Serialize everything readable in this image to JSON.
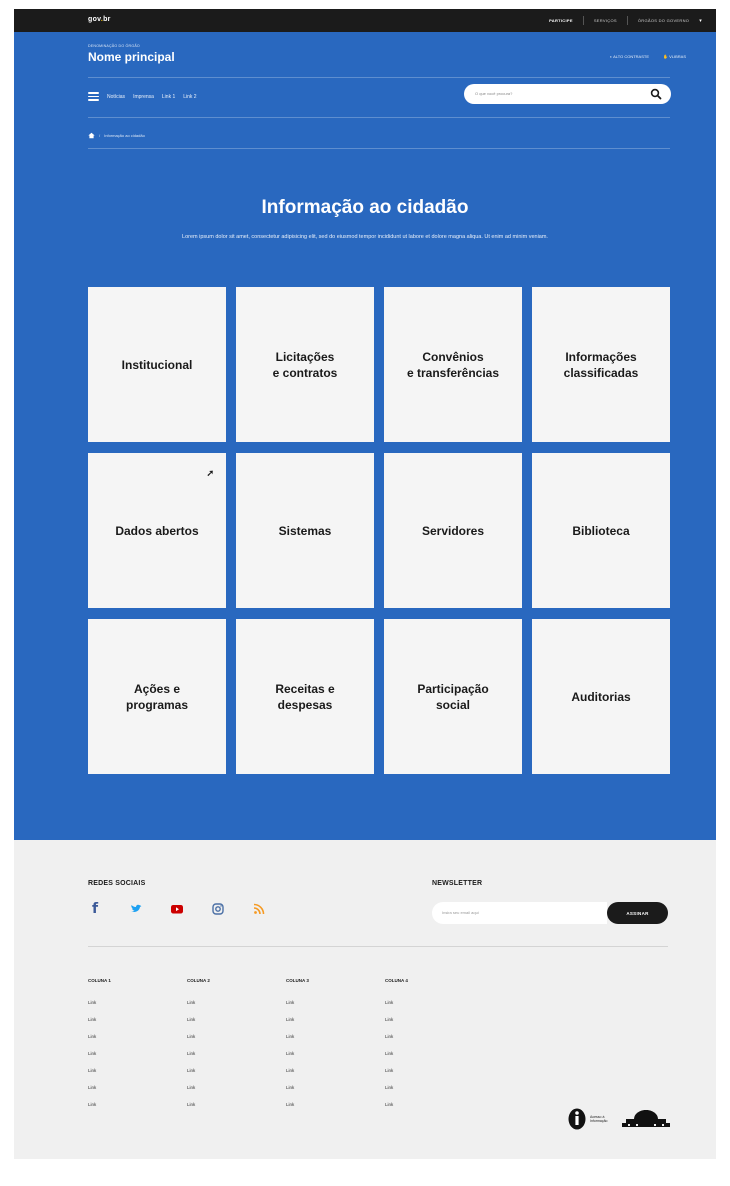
{
  "topbar": {
    "logo_prefix": "gov",
    "logo_dot": ".",
    "logo_suffix": "br",
    "links": [
      "PARTICIPE",
      "SERVIÇOS",
      "ÓRGÃOS DO GOVERNO"
    ]
  },
  "header": {
    "small_label": "DENOMINAÇÃO DO ÓRGÃO",
    "site_name": "Nome principal",
    "contrast_label": "ALTO CONTRASTE",
    "vlibras_label": "VLIBRAS"
  },
  "menu": {
    "items": [
      "Notícias",
      "Imprensa",
      "Link 1",
      "Link 2"
    ]
  },
  "search": {
    "placeholder": "O que você procura?"
  },
  "breadcrumb": {
    "current": "Informação ao cidadão"
  },
  "hero": {
    "title": "Informação ao cidadão",
    "intro": "Lorem ipsum dolor sit amet, consectetur adipisicing elit, sed do eiusmod tempor incididunt ut labore et dolore magna aliqua. Ut enim ad minim veniam."
  },
  "cards": [
    {
      "label": "Institucional"
    },
    {
      "label": "Licitações\ne contratos"
    },
    {
      "label": "Convênios\ne transferências"
    },
    {
      "label": "Informações\nclassificadas"
    },
    {
      "label": "Dados abertos",
      "external": true
    },
    {
      "label": "Sistemas"
    },
    {
      "label": "Servidores"
    },
    {
      "label": "Biblioteca"
    },
    {
      "label": "Ações e\nprogramas"
    },
    {
      "label": "Receitas e\ndespesas"
    },
    {
      "label": "Participação\nsocial"
    },
    {
      "label": "Auditorias"
    }
  ],
  "footer": {
    "social_title": "REDES SOCIAIS",
    "social_icons": [
      "facebook-icon",
      "twitter-icon",
      "youtube-icon",
      "instagram-icon",
      "rss-icon"
    ],
    "newsletter_title": "NEWSLETTER",
    "newsletter_placeholder": "Insira seu email aqui",
    "newsletter_button": "ASSINAR",
    "columns": [
      {
        "title": "COLUNA 1",
        "links": [
          "Link",
          "Link",
          "Link",
          "Link",
          "Link",
          "Link",
          "Link"
        ]
      },
      {
        "title": "COLUNA 2",
        "links": [
          "Link",
          "Link",
          "Link",
          "Link",
          "Link",
          "Link",
          "Link"
        ]
      },
      {
        "title": "COLUNA 3",
        "links": [
          "Link",
          "Link",
          "Link",
          "Link",
          "Link",
          "Link",
          "Link"
        ]
      },
      {
        "title": "COLUNA 4",
        "links": [
          "Link",
          "Link",
          "Link",
          "Link",
          "Link",
          "Link",
          "Link"
        ]
      }
    ],
    "logo_text": "Acesso à Informação"
  },
  "colors": {
    "hero_blue": "#2968bf",
    "topbar": "#1b1b1b",
    "card_bg": "#f5f5f5",
    "footer_bg": "#f0f0f0",
    "facebook": "#3b5998",
    "twitter": "#1da1f2",
    "youtube": "#cc0000",
    "instagram": "#4a6fa5",
    "rss": "#f59a23"
  }
}
